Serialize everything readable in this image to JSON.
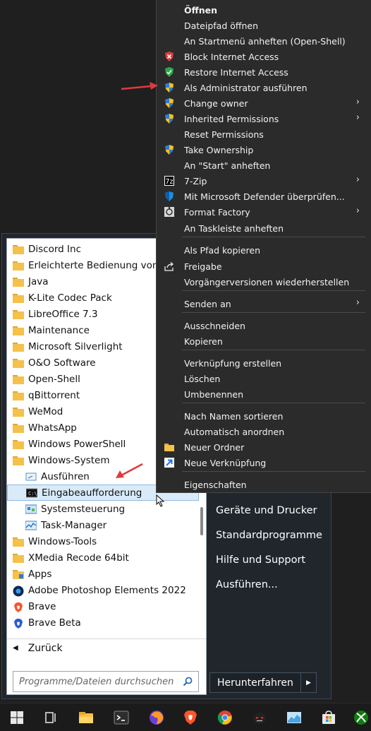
{
  "start_menu": {
    "programs": [
      {
        "label": "Discord Inc",
        "icon": "folder-icon"
      },
      {
        "label": "Erleichterte Bedienung von Windows",
        "icon": "folder-icon"
      },
      {
        "label": "Java",
        "icon": "folder-icon"
      },
      {
        "label": "K-Lite Codec Pack",
        "icon": "folder-icon"
      },
      {
        "label": "LibreOffice 7.3",
        "icon": "folder-icon"
      },
      {
        "label": "Maintenance",
        "icon": "folder-icon"
      },
      {
        "label": "Microsoft Silverlight",
        "icon": "folder-icon"
      },
      {
        "label": "O&O Software",
        "icon": "folder-icon"
      },
      {
        "label": "Open-Shell",
        "icon": "folder-icon"
      },
      {
        "label": "qBittorrent",
        "icon": "folder-icon"
      },
      {
        "label": "WeMod",
        "icon": "folder-icon"
      },
      {
        "label": "WhatsApp",
        "icon": "folder-icon"
      },
      {
        "label": "Windows PowerShell",
        "icon": "folder-icon"
      },
      {
        "label": "Windows-System",
        "icon": "folder-icon"
      },
      {
        "label": "Ausführen",
        "icon": "run-icon"
      },
      {
        "label": "Eingabeaufforderung",
        "icon": "cmd-icon"
      },
      {
        "label": "Systemsteuerung",
        "icon": "control-panel-icon"
      },
      {
        "label": "Task-Manager",
        "icon": "task-manager-icon"
      },
      {
        "label": "Windows-Tools",
        "icon": "folder-icon"
      },
      {
        "label": "XMedia Recode 64bit",
        "icon": "folder-icon"
      },
      {
        "label": "Apps",
        "icon": "apps-icon"
      },
      {
        "label": "Adobe Photoshop Elements 2022",
        "icon": "photoshop-icon"
      },
      {
        "label": "Brave",
        "icon": "brave-icon"
      },
      {
        "label": "Brave Beta",
        "icon": "brave-beta-icon"
      }
    ],
    "back_label": "Zurück",
    "search_placeholder": "Programme/Dateien durchsuchen",
    "right_items": [
      "Geräte und Drucker",
      "Standardprogramme",
      "Hilfe und Support",
      "Ausführen..."
    ],
    "shutdown_label": "Herunterfahren"
  },
  "context_menu": {
    "items": [
      {
        "label": "Öffnen",
        "icon": "",
        "submenu": false
      },
      {
        "label": "Dateipfad öffnen",
        "icon": "",
        "submenu": false
      },
      {
        "label": "An Startmenü anheften (Open-Shell)",
        "icon": "",
        "submenu": false
      },
      {
        "label": "Block Internet Access",
        "icon": "red-shield-icon",
        "submenu": false
      },
      {
        "label": "Restore Internet Access",
        "icon": "green-shield-icon",
        "submenu": false
      },
      {
        "label": "Als Administrator ausführen",
        "icon": "uac-shield-icon",
        "submenu": false
      },
      {
        "label": "Change owner",
        "icon": "uac-shield-icon",
        "submenu": true
      },
      {
        "label": "Inherited Permissions",
        "icon": "uac-shield-icon",
        "submenu": true
      },
      {
        "label": "Reset Permissions",
        "icon": "",
        "submenu": false
      },
      {
        "label": "Take Ownership",
        "icon": "uac-shield-icon",
        "submenu": false
      },
      {
        "label": "An \"Start\" anheften",
        "icon": "",
        "submenu": false
      },
      {
        "label": "7-Zip",
        "icon": "7zip-icon",
        "submenu": true
      },
      {
        "label": "Mit Microsoft Defender überprüfen...",
        "icon": "defender-icon",
        "submenu": false
      },
      {
        "label": "Format Factory",
        "icon": "format-factory-icon",
        "submenu": true
      },
      {
        "label": "An Taskleiste anheften",
        "icon": "",
        "submenu": false
      },
      {
        "label": "Als Pfad kopieren",
        "icon": "",
        "submenu": false
      },
      {
        "label": "Freigabe",
        "icon": "share-icon",
        "submenu": false
      },
      {
        "label": "Vorgängerversionen wiederherstellen",
        "icon": "",
        "submenu": false
      },
      {
        "label": "Senden an",
        "icon": "",
        "submenu": true
      },
      {
        "label": "Ausschneiden",
        "icon": "",
        "submenu": false
      },
      {
        "label": "Kopieren",
        "icon": "",
        "submenu": false
      },
      {
        "label": "Verknüpfung erstellen",
        "icon": "",
        "submenu": false
      },
      {
        "label": "Löschen",
        "icon": "",
        "submenu": false
      },
      {
        "label": "Umbenennen",
        "icon": "",
        "submenu": false
      },
      {
        "label": "Nach Namen sortieren",
        "icon": "",
        "submenu": false
      },
      {
        "label": "Automatisch anordnen",
        "icon": "",
        "submenu": false
      },
      {
        "label": "Neuer Ordner",
        "icon": "folder-icon",
        "submenu": false
      },
      {
        "label": "Neue Verknüpfung",
        "icon": "shortcut-arrow-icon",
        "submenu": false
      },
      {
        "label": "Eigenschaften",
        "icon": "",
        "submenu": false
      }
    ]
  },
  "taskbar": {
    "icons": [
      "windows-start-icon",
      "task-view-icon",
      "file-explorer-icon",
      "terminal-icon",
      "firefox-icon",
      "brave-icon",
      "chrome-icon",
      "game-icon",
      "stocks-icon",
      "store-icon",
      "xbox-icon"
    ]
  },
  "colors": {
    "accent": "#0078d4",
    "menu_bg": "#2b2b2b",
    "start_bg": "#20262c",
    "selection": "#d9ebf9"
  }
}
